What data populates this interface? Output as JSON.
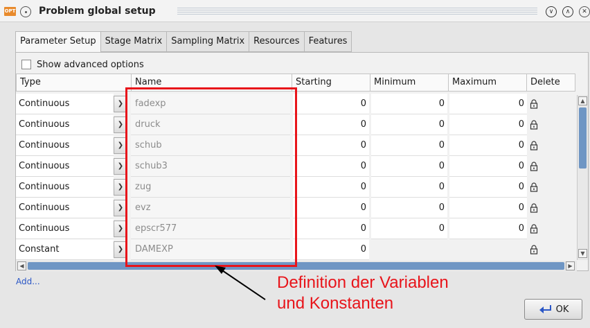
{
  "window": {
    "app_icon_label": "OPT",
    "title": "Problem global setup"
  },
  "tabs": [
    {
      "label": "Parameter Setup",
      "active": true
    },
    {
      "label": "Stage Matrix",
      "active": false
    },
    {
      "label": "Sampling Matrix",
      "active": false
    },
    {
      "label": "Resources",
      "active": false
    },
    {
      "label": "Features",
      "active": false
    }
  ],
  "options": {
    "show_advanced_label": "Show advanced options",
    "show_advanced_checked": false
  },
  "table": {
    "columns": [
      "Type",
      "Name",
      "Starting",
      "Minimum",
      "Maximum",
      "Delete"
    ],
    "rows": [
      {
        "type": "Continuous",
        "name": "fadexp",
        "starting": "0",
        "minimum": "0",
        "maximum": "0"
      },
      {
        "type": "Continuous",
        "name": "druck",
        "starting": "0",
        "minimum": "0",
        "maximum": "0"
      },
      {
        "type": "Continuous",
        "name": "schub",
        "starting": "0",
        "minimum": "0",
        "maximum": "0"
      },
      {
        "type": "Continuous",
        "name": "schub3",
        "starting": "0",
        "minimum": "0",
        "maximum": "0"
      },
      {
        "type": "Continuous",
        "name": "zug",
        "starting": "0",
        "minimum": "0",
        "maximum": "0"
      },
      {
        "type": "Continuous",
        "name": "evz",
        "starting": "0",
        "minimum": "0",
        "maximum": "0"
      },
      {
        "type": "Continuous",
        "name": "epscr577",
        "starting": "0",
        "minimum": "0",
        "maximum": "0"
      },
      {
        "type": "Constant",
        "name": "DAMEXP",
        "starting": "0",
        "minimum": "",
        "maximum": ""
      }
    ]
  },
  "footer": {
    "add_label": "Add...",
    "ok_label": "OK"
  },
  "annotation": {
    "line1": "Definition der Variablen",
    "line2": "und Konstanten",
    "color": "#e8141a"
  },
  "colors": {
    "scroll_thumb": "#6f96c4",
    "link": "#2a56c6"
  }
}
